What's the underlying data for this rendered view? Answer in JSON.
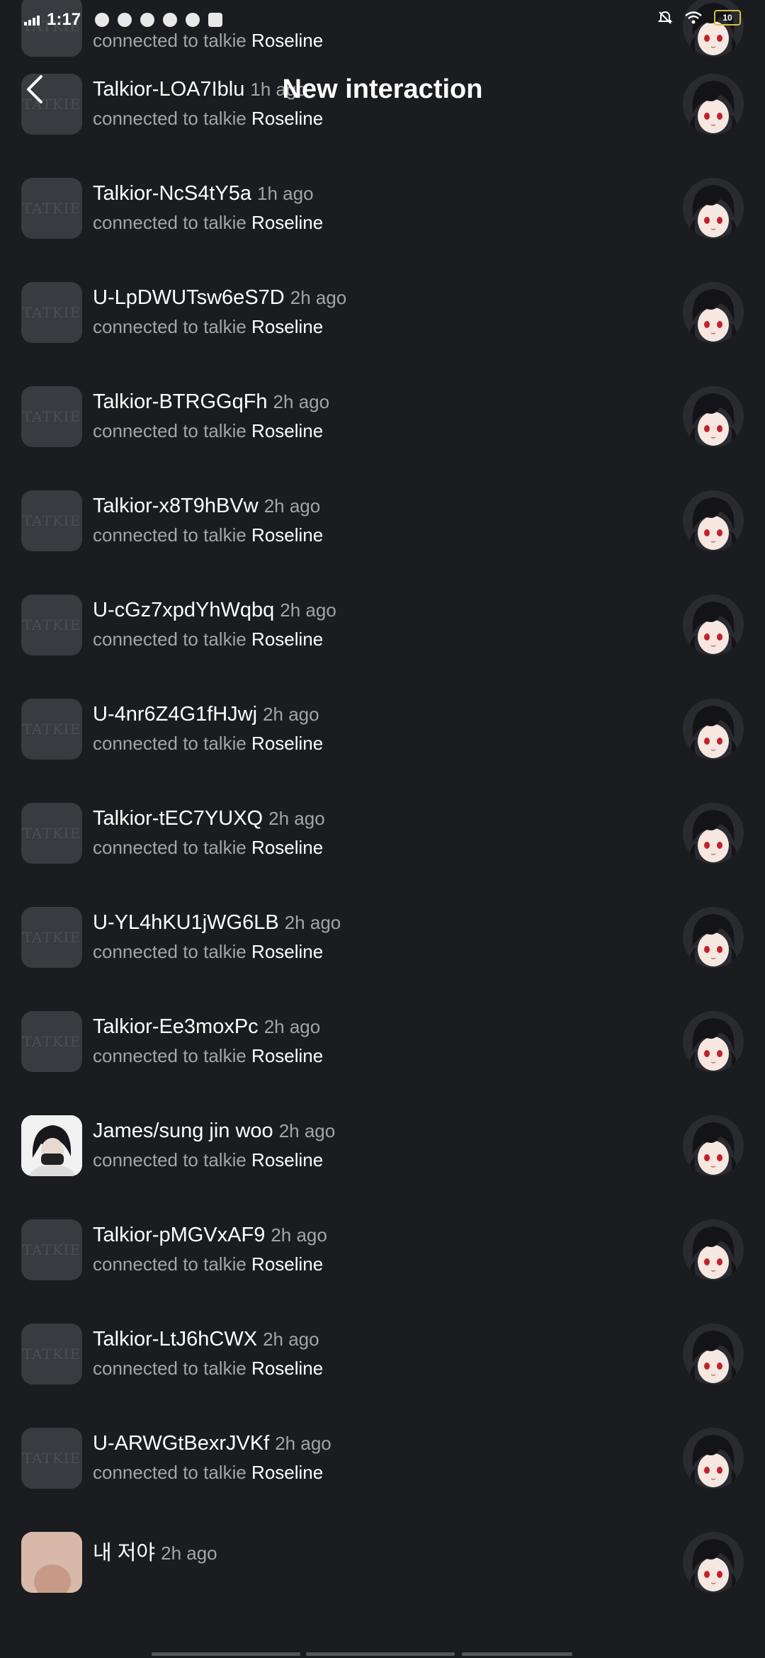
{
  "status_bar": {
    "time": "1:17",
    "battery": "10"
  },
  "header": {
    "title": "New interaction"
  },
  "watermark": "TATKIE",
  "rows": [
    {
      "name": "",
      "time": "",
      "prefix": "connected to talkie",
      "character": "Roseline",
      "avatar": "placeholder"
    },
    {
      "name": "Talkior-LOA7Iblu",
      "time": "1h ago",
      "prefix": "connected to talkie",
      "character": "Roseline",
      "avatar": "placeholder"
    },
    {
      "name": "Talkior-NcS4tY5a",
      "time": "1h ago",
      "prefix": "connected to talkie",
      "character": "Roseline",
      "avatar": "placeholder"
    },
    {
      "name": "U-LpDWUTsw6eS7D",
      "time": "2h ago",
      "prefix": "connected to talkie",
      "character": "Roseline",
      "avatar": "placeholder"
    },
    {
      "name": "Talkior-BTRGGqFh",
      "time": "2h ago",
      "prefix": "connected to talkie",
      "character": "Roseline",
      "avatar": "placeholder"
    },
    {
      "name": "Talkior-x8T9hBVw",
      "time": "2h ago",
      "prefix": "connected to talkie",
      "character": "Roseline",
      "avatar": "placeholder"
    },
    {
      "name": "U-cGz7xpdYhWqbq",
      "time": "2h ago",
      "prefix": "connected to talkie",
      "character": "Roseline",
      "avatar": "placeholder"
    },
    {
      "name": "U-4nr6Z4G1fHJwj",
      "time": "2h ago",
      "prefix": "connected to talkie",
      "character": "Roseline",
      "avatar": "placeholder"
    },
    {
      "name": "Talkior-tEC7YUXQ",
      "time": "2h ago",
      "prefix": "connected to talkie",
      "character": "Roseline",
      "avatar": "placeholder"
    },
    {
      "name": "U-YL4hKU1jWG6LB",
      "time": "2h ago",
      "prefix": "connected to talkie",
      "character": "Roseline",
      "avatar": "placeholder"
    },
    {
      "name": "Talkior-Ee3moxPc",
      "time": "2h ago",
      "prefix": "connected to talkie",
      "character": "Roseline",
      "avatar": "placeholder"
    },
    {
      "name": "James/sung jin woo",
      "time": "2h ago",
      "prefix": "connected to talkie",
      "character": "Roseline",
      "avatar": "photo"
    },
    {
      "name": "Talkior-pMGVxAF9",
      "time": "2h ago",
      "prefix": "connected to talkie",
      "character": "Roseline",
      "avatar": "placeholder"
    },
    {
      "name": "Talkior-LtJ6hCWX",
      "time": "2h ago",
      "prefix": "connected to talkie",
      "character": "Roseline",
      "avatar": "placeholder"
    },
    {
      "name": "U-ARWGtBexrJVKf",
      "time": "2h ago",
      "prefix": "connected to talkie",
      "character": "Roseline",
      "avatar": "placeholder"
    },
    {
      "name": "내 저야",
      "time": "2h ago",
      "prefix": "",
      "character": "",
      "avatar": "photo-skin"
    }
  ]
}
